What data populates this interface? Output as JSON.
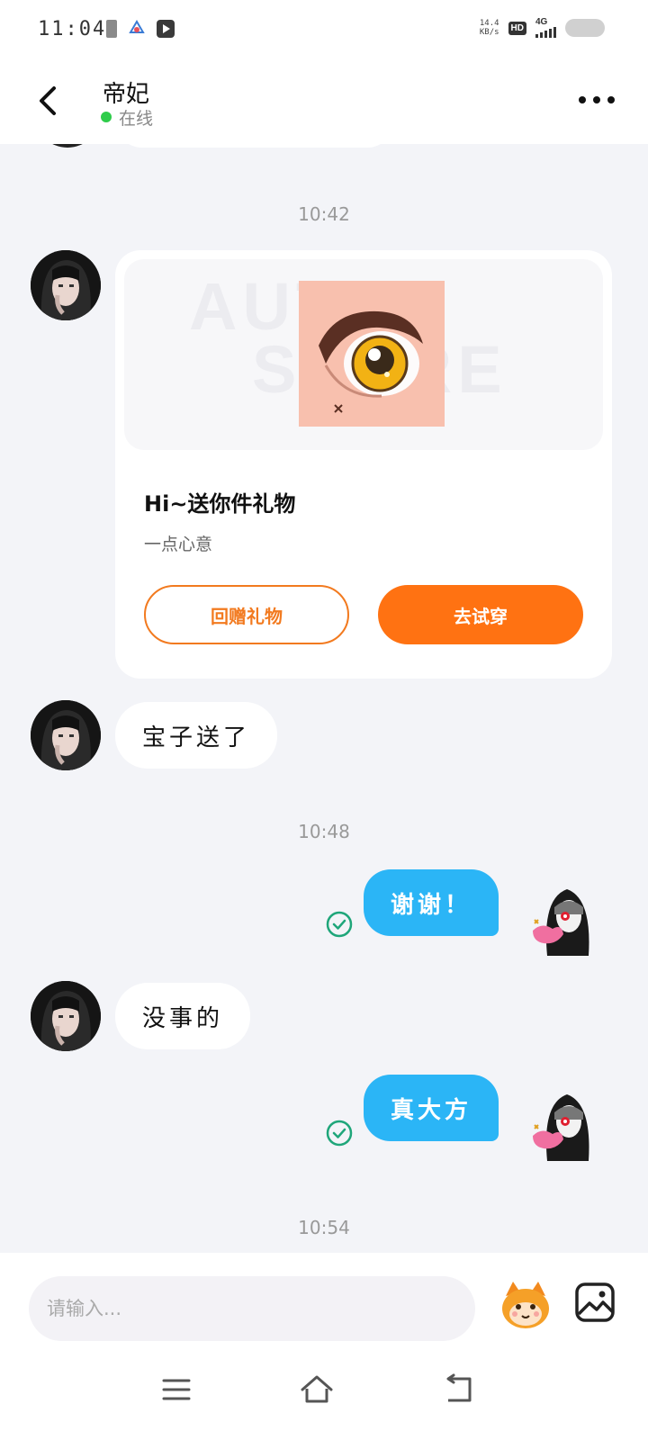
{
  "status_bar": {
    "time": "11:04",
    "speed_value": "14.4",
    "speed_unit": "KB/s",
    "hd_label": "HD",
    "network_label": "4G",
    "icons": [
      "sim-icon",
      "app-icon",
      "media-play-icon",
      "signal-icon",
      "battery-icon"
    ]
  },
  "header": {
    "contact_name": "帝妃",
    "status": "在线",
    "status_color": "#2ecc4a",
    "icons": [
      "back-arrow-icon",
      "more-icon"
    ]
  },
  "messages": [
    {
      "type": "timestamp",
      "text": "10:42"
    },
    {
      "type": "gift_card",
      "from": "her",
      "watermark_line1": "AUTOR",
      "watermark_line2": "STORE",
      "title": "Hi~送你件礼物",
      "subtitle": "一点心意",
      "buttons": {
        "return": "回赠礼物",
        "try_on": "去试穿"
      }
    },
    {
      "type": "text",
      "from": "her",
      "text": "宝子送了"
    },
    {
      "type": "timestamp",
      "text": "10:48"
    },
    {
      "type": "text",
      "from": "me",
      "text": "谢谢！",
      "status": "sent"
    },
    {
      "type": "text",
      "from": "her",
      "text": "没事的"
    },
    {
      "type": "text",
      "from": "me",
      "text": "真大方",
      "status": "sent"
    },
    {
      "type": "timestamp",
      "text": "10:54"
    }
  ],
  "input": {
    "placeholder": "请输入...",
    "icons": [
      "emoji-icon",
      "image-icon"
    ]
  },
  "colors": {
    "accent_orange": "#ff7212",
    "outgoing_bubble": "#2bb5f6",
    "sent_check": "#1fa67a",
    "background": "#f3f4f8"
  },
  "nav_bar": {
    "icons": [
      "menu-icon",
      "home-icon",
      "back-icon"
    ]
  }
}
